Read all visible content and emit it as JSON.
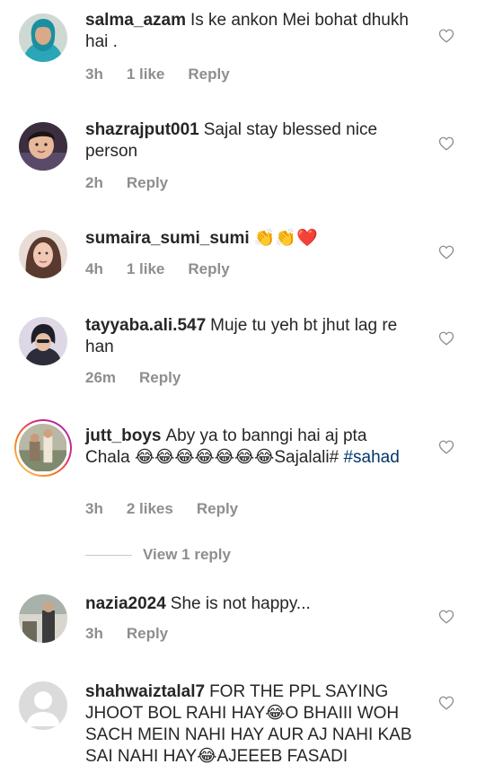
{
  "comments": [
    {
      "username": "salma_azam",
      "text": "Is ke ankon Mei bohat dhukh hai .",
      "time": "3h",
      "likes": "1 like",
      "reply": "Reply"
    },
    {
      "username": "shazrajput001",
      "text": "Sajal stay blessed nice person",
      "time": "2h",
      "reply": "Reply"
    },
    {
      "username": "sumaira_sumi_sumi",
      "text": "👏👏❤️",
      "time": "4h",
      "likes": "1 like",
      "reply": "Reply"
    },
    {
      "username": "tayyaba.ali.547",
      "text": "Muje tu yeh bt jhut lag re han",
      "time": "26m",
      "reply": "Reply"
    },
    {
      "username": "jutt_boys",
      "text_before": "Aby ya to banngi hai aj pta Chala",
      "emoji": "😂😂😂😂😂😂😂",
      "text_after": "Sajalali#",
      "hashtag": "#sahad",
      "time": "3h",
      "likes": "2 likes",
      "reply": "Reply"
    },
    {
      "username": "nazia2024",
      "text": "She is not happy...",
      "time": "3h",
      "reply": "Reply"
    },
    {
      "username": "shahwaiztalal7",
      "text_part1": "FOR THE PPL SAYING JHOOT BOL RAHI HAY",
      "emoji1": "😂",
      "text_part2": "O BHAIII WOH SACH MEIN NAHI HAY AUR AJ NAHI KAB SAI NAHI HAY",
      "emoji2": "😂",
      "text_part3": "AJEEEB FASADI"
    }
  ],
  "view_replies": "View 1 reply",
  "icons": {
    "like": "heart-outline-icon"
  }
}
